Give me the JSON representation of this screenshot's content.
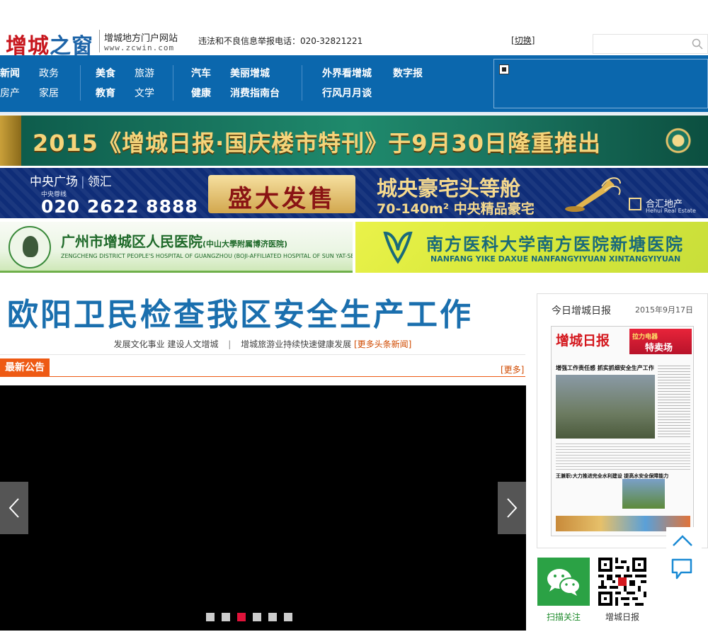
{
  "header": {
    "logo_text_1": "增城",
    "logo_text_2": "之窗",
    "logo_subtitle": "增城地方门户网站",
    "logo_url": "www.zcwin.com",
    "hotline": "违法和不良信息举报电话：020-32821221",
    "switch_label": "切换",
    "search_placeholder": ""
  },
  "nav": {
    "groups": [
      {
        "items": [
          "新闻",
          "政务",
          "房产",
          "家居"
        ]
      },
      {
        "items": [
          "美食",
          "旅游",
          "教育",
          "文学"
        ]
      },
      {
        "items": [
          "汽车",
          "美丽增城",
          "健康",
          "消费指南台"
        ]
      },
      {
        "items": [
          "外界看增城",
          "数字报",
          "行风月月谈"
        ]
      }
    ]
  },
  "banners": {
    "b1": "2015《增城日报·国庆楼市特刊》于9月30日隆重推出",
    "b2_brand_1": "中央广场",
    "b2_brand_2": "领汇",
    "b2_hotline_label": "中央尊线",
    "b2_phone": "020 2622 8888",
    "b2_sale": "盛大发售",
    "b2_head1": "城央豪宅头等舱",
    "b2_head2": "70-140m² 中央精品豪宅",
    "b2_company": "合汇地产",
    "b2_company_en": "Hehui Real Estate",
    "b3_title": "广州市增城区人民医院",
    "b3_title_small": "(中山大學附属博济医院)",
    "b3_en": "ZENGCHENG DISTRICT PEOPLE'S HOSPITAL OF GUANGZHOU (BOJI-AFFILIATED HOSPITAL OF SUN YAT-SEN UNIVERSITY)",
    "b4_title": "南方医科大学南方医院新塘医院",
    "b4_en": "NANFANG YIKE DAXUE NANFANGYIYUAN XINTANGYIYUAN"
  },
  "main": {
    "headline": "欧阳卫民检查我区安全生产工作",
    "sub_link_1": "发展文化事业 建设人文增城",
    "sub_link_2": "增城旅游业持续快速健康发展",
    "more_headlines": "[更多头条新闻]",
    "notice_tag": "最新公告",
    "notice_more": "[更多]",
    "slider_dots": 6,
    "slider_active": 2
  },
  "paper": {
    "title": "今日增城日报",
    "date": "2015年9月17日",
    "masthead": "增城日报",
    "ad_top": "拉力电器",
    "ad_main": "特卖场",
    "headline": "增强工作责任感 抓实抓细安全生产工作",
    "headline2": "王兼职:大力推进完全水利建设 提高水安全保障能力"
  },
  "social": {
    "wechat_label": "扫描关注",
    "qr_label": "增城日报"
  }
}
